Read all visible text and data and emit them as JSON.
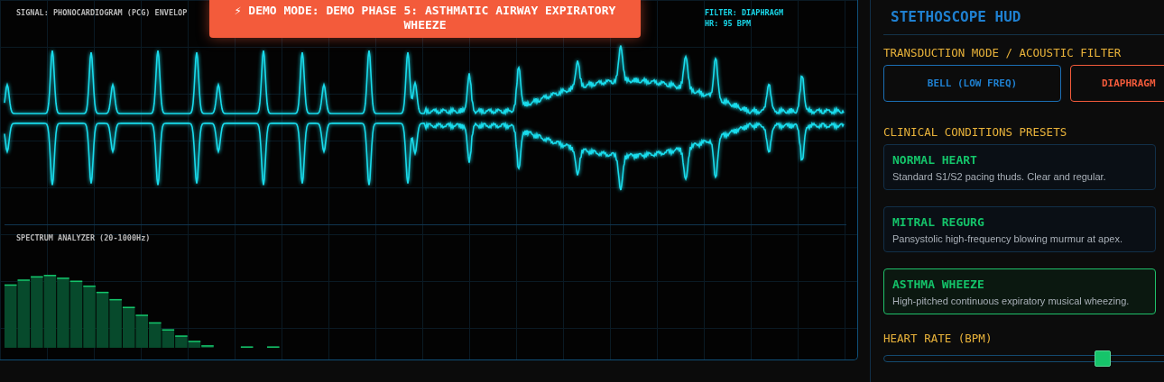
{
  "monitor": {
    "signal_label": "SIGNAL: PHONOCARDIOGRAM (PCG) ENVELOP",
    "readouts": [
      "FILTER: DIAPHRAGM",
      "HR: 95 BPM"
    ],
    "spectrum_label": "SPECTRUM ANALYZER (20-1000Hz)"
  },
  "banner": {
    "text": "⚡ DEMO MODE: DEMO PHASE 5: ASTHMATIC AIRWAY EXPIRATORY WHEEZE"
  },
  "sidebar": {
    "title": "STETHOSCOPE HUD",
    "filter_section": {
      "label": "TRANSDUCTION MODE / ACOUSTIC FILTER",
      "options": [
        {
          "label": "BELL (LOW FREQ)",
          "selected": false
        },
        {
          "label": "DIAPHRAGM",
          "selected": true
        }
      ]
    },
    "presets_section": {
      "label": "CLINICAL CONDITIONS PRESETS",
      "presets": [
        {
          "name": "NORMAL HEART",
          "description": "Standard S1/S2 pacing thuds. Clear and regular.",
          "selected": false
        },
        {
          "name": "MITRAL REGURG",
          "description": "Pansystolic high-frequency blowing murmur at apex.",
          "selected": false
        },
        {
          "name": "ASTHMA WHEEZE",
          "description": "High-pitched continuous expiratory musical wheezing.",
          "selected": true
        }
      ]
    },
    "heart_rate": {
      "label": "HEART RATE (BPM)",
      "level": 0.5
    }
  }
}
